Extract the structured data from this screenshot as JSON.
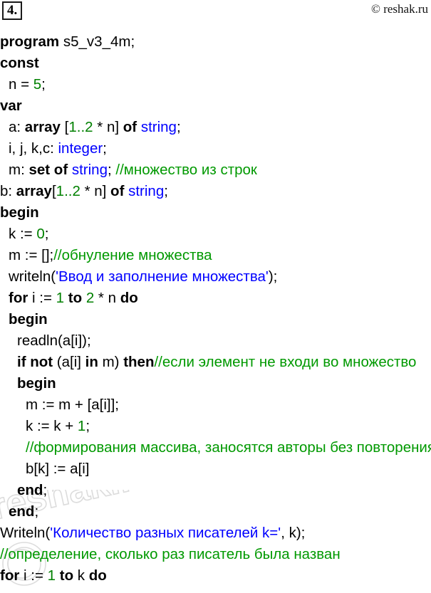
{
  "header": {
    "task_number": "4.",
    "copyright": "© reshak.ru"
  },
  "watermark": {
    "text": "reshak.ru",
    "symbol": "©",
    "color": "#d8d8d8"
  },
  "colors": {
    "keyword": "#000000",
    "number": "#008000",
    "type": "#0000ff",
    "string": "#0000ff",
    "comment": "#009900",
    "plain": "#000000",
    "background": "#ffffff"
  },
  "code": {
    "language": "pascal",
    "program_name": "s5_v3_4m",
    "lines": [
      {
        "id": 1,
        "indent": 0,
        "tokens": [
          {
            "t": "program ",
            "c": "kw"
          },
          {
            "t": "s5_v3_4m;",
            "c": "pln"
          }
        ]
      },
      {
        "id": 2,
        "indent": 0,
        "tokens": [
          {
            "t": "const",
            "c": "kw"
          }
        ]
      },
      {
        "id": 3,
        "indent": 1,
        "tokens": [
          {
            "t": "n = ",
            "c": "pln"
          },
          {
            "t": "5",
            "c": "num"
          },
          {
            "t": ";",
            "c": "pln"
          }
        ]
      },
      {
        "id": 4,
        "indent": 0,
        "tokens": [
          {
            "t": "var",
            "c": "kw"
          }
        ]
      },
      {
        "id": 5,
        "indent": 1,
        "tokens": [
          {
            "t": "a: ",
            "c": "pln"
          },
          {
            "t": "array",
            "c": "kw"
          },
          {
            "t": " [",
            "c": "pln"
          },
          {
            "t": "1..2",
            "c": "num"
          },
          {
            "t": " * n] ",
            "c": "pln"
          },
          {
            "t": "of",
            "c": "kw"
          },
          {
            "t": " ",
            "c": "pln"
          },
          {
            "t": "string",
            "c": "typ"
          },
          {
            "t": ";",
            "c": "pln"
          }
        ]
      },
      {
        "id": 6,
        "indent": 1,
        "tokens": [
          {
            "t": "i, j, k,c: ",
            "c": "pln"
          },
          {
            "t": "integer",
            "c": "typ"
          },
          {
            "t": ";",
            "c": "pln"
          }
        ]
      },
      {
        "id": 7,
        "indent": 1,
        "tokens": [
          {
            "t": "m: ",
            "c": "pln"
          },
          {
            "t": "set of",
            "c": "kw"
          },
          {
            "t": " ",
            "c": "pln"
          },
          {
            "t": "string",
            "c": "typ"
          },
          {
            "t": "; ",
            "c": "pln"
          },
          {
            "t": "//множество из строк",
            "c": "cmt"
          }
        ]
      },
      {
        "id": 8,
        "indent": 0,
        "tokens": [
          {
            "t": "b: ",
            "c": "pln"
          },
          {
            "t": "array",
            "c": "kw"
          },
          {
            "t": "[",
            "c": "pln"
          },
          {
            "t": "1..2",
            "c": "num"
          },
          {
            "t": " * n] ",
            "c": "pln"
          },
          {
            "t": "of",
            "c": "kw"
          },
          {
            "t": " ",
            "c": "pln"
          },
          {
            "t": "string",
            "c": "typ"
          },
          {
            "t": ";",
            "c": "pln"
          }
        ]
      },
      {
        "id": 9,
        "indent": 0,
        "tokens": [
          {
            "t": "begin",
            "c": "kw"
          }
        ]
      },
      {
        "id": 10,
        "indent": 1,
        "tokens": [
          {
            "t": "k := ",
            "c": "pln"
          },
          {
            "t": "0",
            "c": "num"
          },
          {
            "t": ";",
            "c": "pln"
          }
        ]
      },
      {
        "id": 11,
        "indent": 1,
        "tokens": [
          {
            "t": "m := [];",
            "c": "pln"
          },
          {
            "t": "//обнуление множества",
            "c": "cmt"
          }
        ]
      },
      {
        "id": 12,
        "indent": 1,
        "tokens": [
          {
            "t": "writeln(",
            "c": "pln"
          },
          {
            "t": "'Ввод и заполнение множества'",
            "c": "str"
          },
          {
            "t": ");",
            "c": "pln"
          }
        ]
      },
      {
        "id": 13,
        "indent": 1,
        "tokens": [
          {
            "t": "for",
            "c": "kw"
          },
          {
            "t": " i := ",
            "c": "pln"
          },
          {
            "t": "1",
            "c": "num"
          },
          {
            "t": " ",
            "c": "pln"
          },
          {
            "t": "to",
            "c": "kw"
          },
          {
            "t": " ",
            "c": "pln"
          },
          {
            "t": "2",
            "c": "num"
          },
          {
            "t": " * n ",
            "c": "pln"
          },
          {
            "t": "do",
            "c": "kw"
          }
        ]
      },
      {
        "id": 14,
        "indent": 1,
        "tokens": [
          {
            "t": "begin",
            "c": "kw"
          }
        ]
      },
      {
        "id": 15,
        "indent": 2,
        "tokens": [
          {
            "t": "readln(a[i]);",
            "c": "pln"
          }
        ]
      },
      {
        "id": 16,
        "indent": 2,
        "tokens": [
          {
            "t": "if not",
            "c": "kw"
          },
          {
            "t": " (a[i] ",
            "c": "pln"
          },
          {
            "t": "in",
            "c": "kw"
          },
          {
            "t": " m) ",
            "c": "pln"
          },
          {
            "t": "then",
            "c": "kw"
          },
          {
            "t": "//если элемент не входи во множество",
            "c": "cmt"
          }
        ]
      },
      {
        "id": 17,
        "indent": 2,
        "tokens": [
          {
            "t": "begin",
            "c": "kw"
          }
        ]
      },
      {
        "id": 18,
        "indent": 3,
        "tokens": [
          {
            "t": "m := m + [a[i]];",
            "c": "pln"
          }
        ]
      },
      {
        "id": 19,
        "indent": 3,
        "tokens": [
          {
            "t": "k := k + ",
            "c": "pln"
          },
          {
            "t": "1",
            "c": "num"
          },
          {
            "t": ";",
            "c": "pln"
          }
        ]
      },
      {
        "id": 20,
        "indent": 3,
        "tokens": [
          {
            "t": "//формирования массива, заносятся авторы без повторения",
            "c": "cmt"
          }
        ]
      },
      {
        "id": 21,
        "indent": 3,
        "tokens": [
          {
            "t": "b[k] := a[i]",
            "c": "pln"
          }
        ]
      },
      {
        "id": 22,
        "indent": 2,
        "tokens": [
          {
            "t": "end",
            "c": "kw"
          },
          {
            "t": ";",
            "c": "pln"
          }
        ]
      },
      {
        "id": 23,
        "indent": 1,
        "tokens": [
          {
            "t": "end",
            "c": "kw"
          },
          {
            "t": ";",
            "c": "pln"
          }
        ]
      },
      {
        "id": 24,
        "indent": 0,
        "tokens": [
          {
            "t": "Writeln(",
            "c": "pln"
          },
          {
            "t": "'Количество разных писателей k='",
            "c": "str"
          },
          {
            "t": ", k);",
            "c": "pln"
          }
        ]
      },
      {
        "id": 25,
        "indent": 0,
        "tokens": [
          {
            "t": "//определение, сколько раз писатель была назван",
            "c": "cmt"
          }
        ]
      },
      {
        "id": 26,
        "indent": 0,
        "tokens": [
          {
            "t": "for",
            "c": "kw"
          },
          {
            "t": " i := ",
            "c": "pln"
          },
          {
            "t": "1",
            "c": "num"
          },
          {
            "t": " ",
            "c": "pln"
          },
          {
            "t": "to",
            "c": "kw"
          },
          {
            "t": " k ",
            "c": "pln"
          },
          {
            "t": "do",
            "c": "kw"
          }
        ]
      }
    ]
  }
}
